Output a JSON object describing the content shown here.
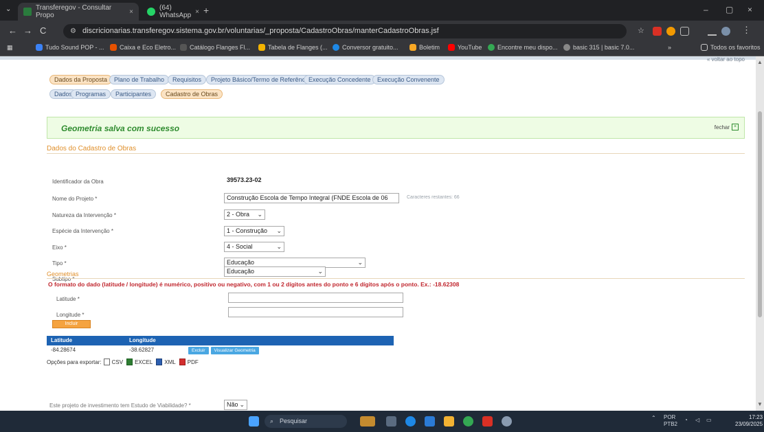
{
  "browser": {
    "tabs": [
      {
        "title": "Transferegov - Consultar Propo",
        "close": "×",
        "active": true
      },
      {
        "title": "(64) WhatsApp",
        "close": "×",
        "active": false
      }
    ],
    "newtab": "+",
    "window_controls": [
      "–",
      "▢",
      "×"
    ],
    "url": "discricionarias.transferegov.sistema.gov.br/voluntarias/_proposta/CadastroObras/manterCadastroObras.jsf",
    "nav": {
      "back": "←",
      "forward": "→",
      "reload": "C"
    },
    "bookmarks": [
      "Tudo Sound POP - ...",
      "Caixa e Eco Eletro...",
      "Catálogo Flanges Fl...",
      "Tabela de Flanges (...",
      "Conversor gratuito...",
      "Boletim",
      "YouTube",
      "Encontre meu dispo...",
      "basic 315 | basic 7.0..."
    ],
    "bookmarks_more": "»",
    "bookmarks_all": "Todos os favoritos",
    "top_link": "« voltar ao topo"
  },
  "tabs_primary": [
    "Dados da Proposta",
    "Plano de Trabalho",
    "Requisitos",
    "Projeto Básico/Termo de Referência",
    "Execução Concedente",
    "Execução Convenente"
  ],
  "tabs_secondary": [
    "Dados",
    "Programas",
    "Participantes",
    "Cadastro de Obras"
  ],
  "success": {
    "message": "Geometria salva com sucesso",
    "close_label": "fechar",
    "close_icon": "×"
  },
  "section": {
    "title": "Dados do Cadastro de Obras",
    "fields": {
      "identificador_label": "Identificador da Obra",
      "identificador_value": "39573.23-02",
      "nome_label": "Nome do Projeto *",
      "nome_value": "Construção Escola de Tempo Integral (FNDE Escola de 06",
      "nome_hint": "Caracteres restantes: 66",
      "natureza_label": "Natureza da Intervenção *",
      "natureza_value": "2 - Obra",
      "especie_label": "Espécie da Intervenção *",
      "especie_value": "1 - Construção",
      "eixo_label": "Eixo *",
      "eixo_value": "4 - Social",
      "tipo_label": "Tipo *",
      "tipo_value": "Educação",
      "subtipo_label": "Subtipo *",
      "subtipo_value": "Educação"
    }
  },
  "geometria": {
    "title": "Geometrias",
    "warning": "O formato do dado (latitude / longitude) é numérico, positivo ou negativo, com 1 ou 2 dígitos antes do ponto e 6 dígitos após o ponto. Ex.: -18.62308",
    "latitude_label": "Latitude *",
    "longitude_label": "Longitude *",
    "add_button": "Incluir",
    "table_headers": [
      "Latitude",
      "Longitude"
    ],
    "rows": [
      {
        "lat": "-84.28674",
        "lng": "-38.62827"
      }
    ],
    "row_actions": [
      "Excluir",
      "Visualizar Geometria"
    ]
  },
  "export": {
    "label": "Opções para exportar:",
    "items": [
      "CSV",
      "EXCEL",
      "XML",
      "PDF"
    ]
  },
  "question": {
    "label": "Este projeto de investimento tem Estudo de Viabilidade? *",
    "value": "Não"
  },
  "taskbar": {
    "search_placeholder": "Pesquisar",
    "lang": "POR",
    "lang_sub": "PTB2",
    "time": "17:23",
    "date": "23/09/2025"
  }
}
